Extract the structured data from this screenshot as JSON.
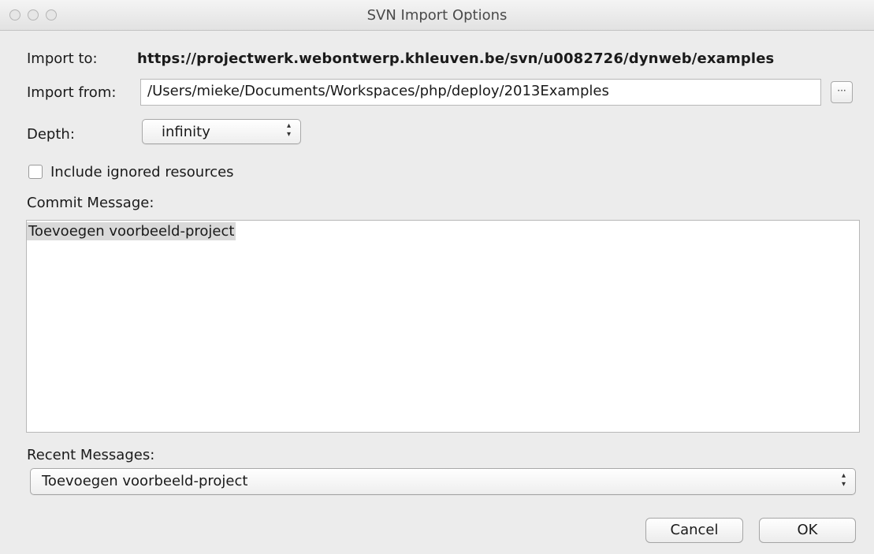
{
  "window": {
    "title": "SVN Import Options"
  },
  "import_to": {
    "label": "Import to:",
    "value": "https://projectwerk.webontwerp.khleuven.be/svn/u0082726/dynweb/examples"
  },
  "import_from": {
    "label": "Import from:",
    "value": "/Users/mieke/Documents/Workspaces/php/deploy/2013Examples",
    "browse_label": "···"
  },
  "depth": {
    "label": "Depth:",
    "selected": "infinity"
  },
  "include_ignored": {
    "label": "Include ignored resources",
    "checked": false
  },
  "commit": {
    "label": "Commit Message:",
    "text": "Toevoegen voorbeeld-project"
  },
  "recent": {
    "label": "Recent Messages:",
    "selected": "Toevoegen voorbeeld-project"
  },
  "buttons": {
    "cancel": "Cancel",
    "ok": "OK"
  },
  "icons": {
    "traffic": [
      "close-icon",
      "minimize-icon",
      "zoom-icon"
    ],
    "dropdown": "up-down-chevron-icon"
  }
}
